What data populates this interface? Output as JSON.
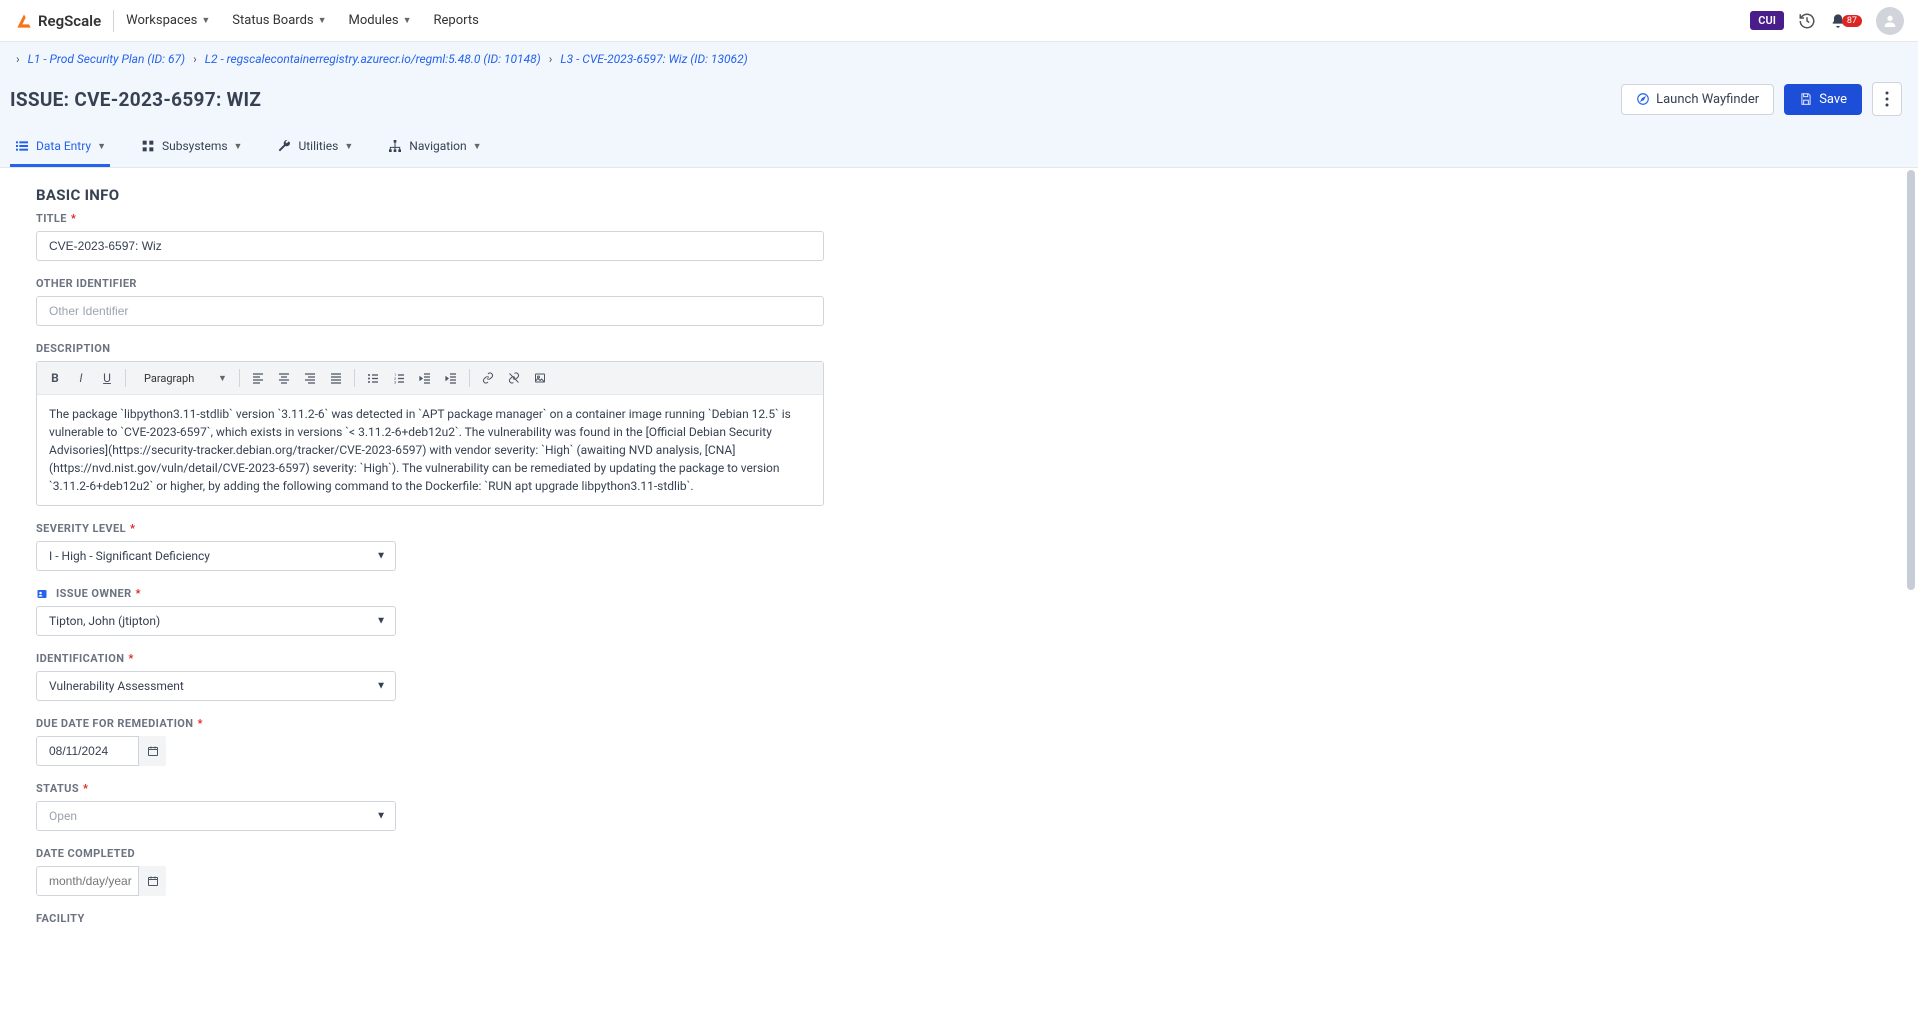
{
  "topnav": {
    "brand": "RegScale",
    "items": [
      "Workspaces",
      "Status Boards",
      "Modules",
      "Reports"
    ],
    "cui": "CUI",
    "notif_count": "87"
  },
  "breadcrumbs": [
    "L1 - Prod Security Plan (ID: 67)",
    "L2 - regscalecontainerregistry.azurecr.io/regml:5.48.0 (ID: 10148)",
    "L3 - CVE-2023-6597: Wiz (ID: 13062)"
  ],
  "header": {
    "title": "ISSUE: CVE-2023-6597: WIZ",
    "launch": "Launch Wayfinder",
    "save": "Save"
  },
  "tabs": [
    "Data Entry",
    "Subsystems",
    "Utilities",
    "Navigation"
  ],
  "form": {
    "section_title": "BASIC INFO",
    "title_label": "TITLE",
    "title_value": "CVE-2023-6597: Wiz",
    "other_id_label": "OTHER IDENTIFIER",
    "other_id_placeholder": "Other Identifier",
    "desc_label": "DESCRIPTION",
    "rte_format": "Paragraph",
    "desc_value": "The package `libpython3.11-stdlib` version `3.11.2-6` was detected in `APT package manager` on a container image running `Debian 12.5` is vulnerable to `CVE-2023-6597`, which exists in versions `< 3.11.2-6+deb12u2`. The vulnerability was found in the [Official Debian Security Advisories](https://security-tracker.debian.org/tracker/CVE-2023-6597) with vendor severity: `High` (awaiting NVD analysis, [CNA](https://nvd.nist.gov/vuln/detail/CVE-2023-6597) severity: `High`). The vulnerability can be remediated by updating the package to version `3.11.2-6+deb12u2` or higher, by adding the following command to the Dockerfile: `RUN apt upgrade libpython3.11-stdlib`.",
    "severity_label": "SEVERITY LEVEL",
    "severity_value": "I - High - Significant Deficiency",
    "owner_label": "ISSUE OWNER",
    "owner_value": "Tipton, John (jtipton)",
    "ident_label": "IDENTIFICATION",
    "ident_value": "Vulnerability Assessment",
    "due_label": "DUE DATE FOR REMEDIATION",
    "due_value": "08/11/2024",
    "status_label": "STATUS",
    "status_value": "Open",
    "completed_label": "DATE COMPLETED",
    "completed_placeholder": "month/day/year",
    "facility_label": "FACILITY"
  }
}
